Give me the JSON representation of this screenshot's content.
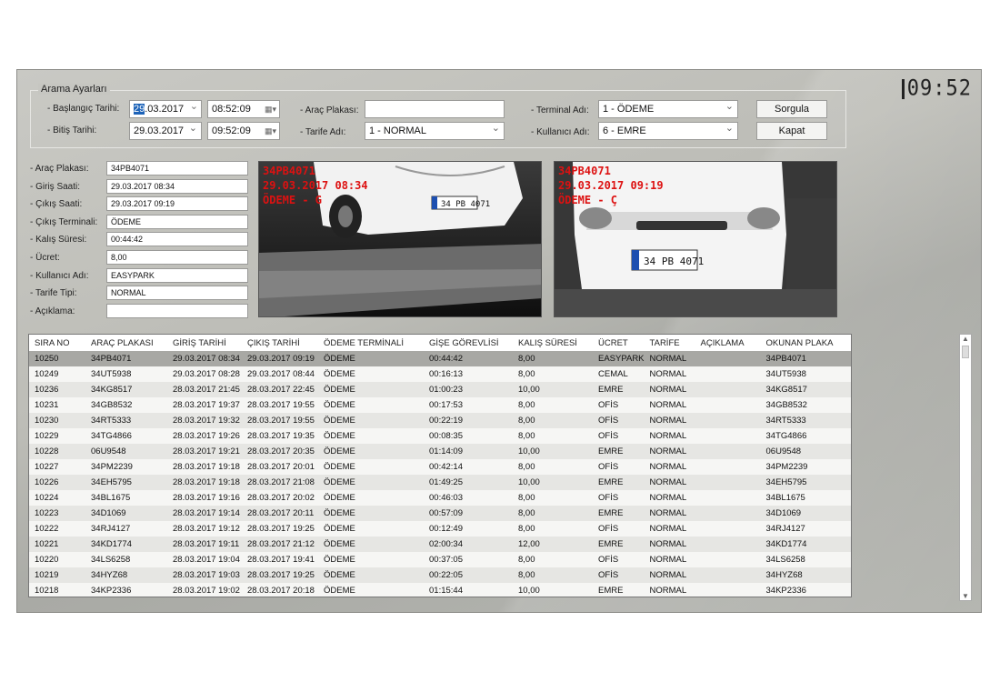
{
  "clock": "09:52",
  "search": {
    "title": "Arama Ayarları",
    "start_date_label": "Başlangıç Tarihi:",
    "start_date_day": "29",
    "start_date_rest": ".03.2017",
    "start_time": "08:52:09",
    "end_date_label": "Bitiş Tarihi:",
    "end_date": "29.03.2017",
    "end_time": "09:52:09",
    "plate_label": "Araç Plakası:",
    "plate_value": "",
    "tariff_label": "Tarife Adı:",
    "tariff_value": "1 - NORMAL",
    "terminal_label": "Terminal Adı:",
    "terminal_value": "1 - ÖDEME",
    "user_label": "Kullanıcı Adı:",
    "user_value": "6 - EMRE",
    "query_button": "Sorgula",
    "close_button": "Kapat"
  },
  "details": [
    {
      "label": "Araç Plakası:",
      "value": "34PB4071"
    },
    {
      "label": "Giriş Saati:",
      "value": "29.03.2017 08:34"
    },
    {
      "label": "Çıkış Saati:",
      "value": "29.03.2017 09:19"
    },
    {
      "label": "Çıkış Terminali:",
      "value": "ÖDEME"
    },
    {
      "label": "Kalış Süresi:",
      "value": "00:44:42"
    },
    {
      "label": "Ücret:",
      "value": "8,00"
    },
    {
      "label": "Kullanıcı Adı:",
      "value": "EASYPARK"
    },
    {
      "label": "Tarife Tipi:",
      "value": "NORMAL"
    },
    {
      "label": "Açıklama:",
      "value": ""
    }
  ],
  "camera_entry": {
    "line1": "34PB4071",
    "line2": "29.03.2017 08:34",
    "line3": "ÖDEME - G",
    "plate": "34 PB 4071"
  },
  "camera_exit": {
    "line1": "34PB4071",
    "line2": "29.03.2017 09:19",
    "line3": "ÖDEME - Ç",
    "plate": "34 PB 4071"
  },
  "table": {
    "headers": [
      "SIRA NO",
      "ARAÇ PLAKASI",
      "GİRİŞ TARİHİ",
      "ÇIKIŞ TARİHİ",
      "ÖDEME TERMİNALİ",
      "GİŞE GÖREVLİSİ",
      "KALIŞ SÜRESİ",
      "ÜCRET",
      "TARİFE",
      "AÇIKLAMA",
      "OKUNAN PLAKA"
    ],
    "rows": [
      [
        "10250",
        "34PB4071",
        "29.03.2017 08:34",
        "29.03.2017 09:19",
        "ÖDEME",
        "00:44:42",
        "8,00",
        "EASYPARK",
        "NORMAL",
        "",
        "34PB4071"
      ],
      [
        "10249",
        "34UT5938",
        "29.03.2017 08:28",
        "29.03.2017 08:44",
        "ÖDEME",
        "00:16:13",
        "8,00",
        "CEMAL",
        "NORMAL",
        "",
        "34UT5938"
      ],
      [
        "10236",
        "34KG8517",
        "28.03.2017 21:45",
        "28.03.2017 22:45",
        "ÖDEME",
        "01:00:23",
        "10,00",
        "EMRE",
        "NORMAL",
        "",
        "34KG8517"
      ],
      [
        "10231",
        "34GB8532",
        "28.03.2017 19:37",
        "28.03.2017 19:55",
        "ÖDEME",
        "00:17:53",
        "8,00",
        "OFİS",
        "NORMAL",
        "",
        "34GB8532"
      ],
      [
        "10230",
        "34RT5333",
        "28.03.2017 19:32",
        "28.03.2017 19:55",
        "ÖDEME",
        "00:22:19",
        "8,00",
        "OFİS",
        "NORMAL",
        "",
        "34RT5333"
      ],
      [
        "10229",
        "34TG4866",
        "28.03.2017 19:26",
        "28.03.2017 19:35",
        "ÖDEME",
        "00:08:35",
        "8,00",
        "OFİS",
        "NORMAL",
        "",
        "34TG4866"
      ],
      [
        "10228",
        "06U9548",
        "28.03.2017 19:21",
        "28.03.2017 20:35",
        "ÖDEME",
        "01:14:09",
        "10,00",
        "EMRE",
        "NORMAL",
        "",
        "06U9548"
      ],
      [
        "10227",
        "34PM2239",
        "28.03.2017 19:18",
        "28.03.2017 20:01",
        "ÖDEME",
        "00:42:14",
        "8,00",
        "OFİS",
        "NORMAL",
        "",
        "34PM2239"
      ],
      [
        "10226",
        "34EH5795",
        "28.03.2017 19:18",
        "28.03.2017 21:08",
        "ÖDEME",
        "01:49:25",
        "10,00",
        "EMRE",
        "NORMAL",
        "",
        "34EH5795"
      ],
      [
        "10224",
        "34BL1675",
        "28.03.2017 19:16",
        "28.03.2017 20:02",
        "ÖDEME",
        "00:46:03",
        "8,00",
        "OFİS",
        "NORMAL",
        "",
        "34BL1675"
      ],
      [
        "10223",
        "34D1069",
        "28.03.2017 19:14",
        "28.03.2017 20:11",
        "ÖDEME",
        "00:57:09",
        "8,00",
        "EMRE",
        "NORMAL",
        "",
        "34D1069"
      ],
      [
        "10222",
        "34RJ4127",
        "28.03.2017 19:12",
        "28.03.2017 19:25",
        "ÖDEME",
        "00:12:49",
        "8,00",
        "OFİS",
        "NORMAL",
        "",
        "34RJ4127"
      ],
      [
        "10221",
        "34KD1774",
        "28.03.2017 19:11",
        "28.03.2017 21:12",
        "ÖDEME",
        "02:00:34",
        "12,00",
        "EMRE",
        "NORMAL",
        "",
        "34KD1774"
      ],
      [
        "10220",
        "34LS6258",
        "28.03.2017 19:04",
        "28.03.2017 19:41",
        "ÖDEME",
        "00:37:05",
        "8,00",
        "OFİS",
        "NORMAL",
        "",
        "34LS6258"
      ],
      [
        "10219",
        "34HYZ68",
        "28.03.2017 19:03",
        "28.03.2017 19:25",
        "ÖDEME",
        "00:22:05",
        "8,00",
        "OFİS",
        "NORMAL",
        "",
        "34HYZ68"
      ],
      [
        "10218",
        "34KP2336",
        "28.03.2017 19:02",
        "28.03.2017 20:18",
        "ÖDEME",
        "01:15:44",
        "10,00",
        "EMRE",
        "NORMAL",
        "",
        "34KP2336"
      ]
    ]
  }
}
